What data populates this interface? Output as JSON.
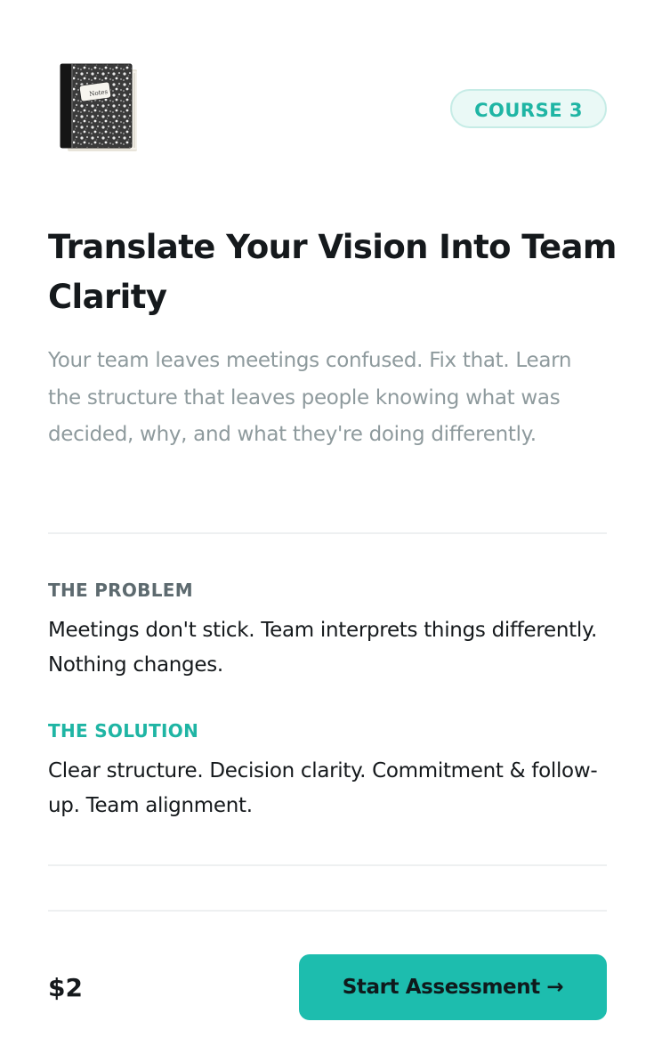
{
  "header": {
    "icon": "notebook-icon",
    "icon_label": "Notes",
    "badge": "COURSE 3"
  },
  "course": {
    "title": "Translate Your Vision Into Team Clarity",
    "description": "Your team leaves meetings confused. Fix that. Learn the structure that leaves people knowing what was decided, why, and what they're doing differently."
  },
  "problem": {
    "label": "THE PROBLEM",
    "text": "Meetings don't stick. Team interprets things differently. Nothing changes."
  },
  "solution": {
    "label": "THE SOLUTION",
    "text": "Clear structure. Decision clarity. Commitment & follow-up. Team alignment."
  },
  "footer": {
    "price": "$2",
    "cta_label": "Start Assessment →"
  },
  "colors": {
    "accent": "#1dbdae",
    "accent_text": "#1fb5a4",
    "muted_text": "#8e9a9d",
    "label_gray": "#5d6a6f",
    "dark_text": "#15191c"
  }
}
